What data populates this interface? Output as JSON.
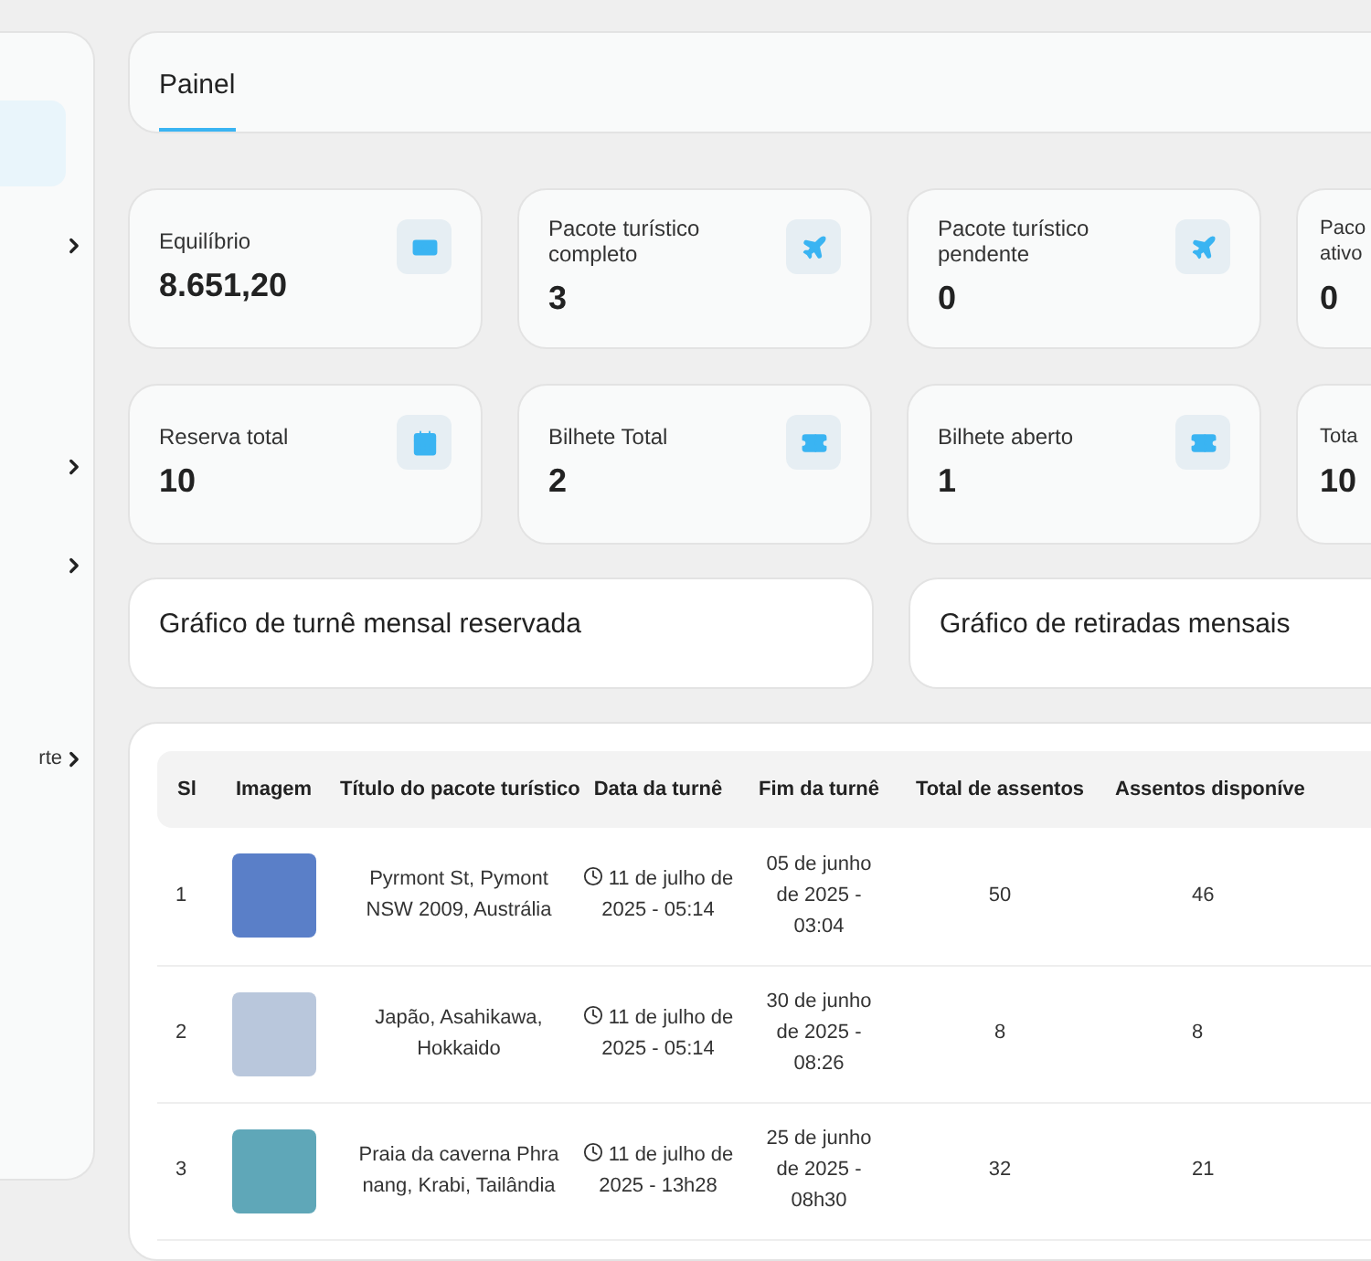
{
  "sidebar": {
    "items": [
      {
        "kind": "highlight"
      },
      {
        "kind": "chevron"
      },
      {
        "kind": "chevron"
      },
      {
        "kind": "chevron"
      },
      {
        "kind": "chevron",
        "label": "rte"
      }
    ]
  },
  "tabs": [
    {
      "label": "Painel",
      "selected": true
    }
  ],
  "stats": [
    {
      "label": "Equilíbrio",
      "value": "8.651,20",
      "kind": "money"
    },
    {
      "label": "Pacote turístico completo",
      "value": "3",
      "kind": "plane"
    },
    {
      "label": "Pacote turístico pendente",
      "value": "0",
      "kind": "plane"
    },
    {
      "label": "Paco ativo",
      "value": "0",
      "kind": "cut"
    },
    {
      "label": "Reserva total",
      "value": "10",
      "kind": "calendar"
    },
    {
      "label": "Bilhete Total",
      "value": "2",
      "kind": "ticket"
    },
    {
      "label": "Bilhete aberto",
      "value": "1",
      "kind": "ticket"
    },
    {
      "label": "Tota",
      "value": "10",
      "kind": "cut"
    }
  ],
  "charts": [
    {
      "title": "Gráfico de turnê mensal reservada"
    },
    {
      "title": "Gráfico de retiradas mensais"
    }
  ],
  "table": {
    "columns": [
      "Sl",
      "Imagem",
      "Título do pacote turístico",
      "Data da turnê",
      "Fim da turnê",
      "Total de assentos",
      "Assentos disponíve"
    ],
    "rows": [
      {
        "sl": "1",
        "title": "Pyrmont St, Pymont NSW 2009, Austrália",
        "date": "11 de julho de 2025 - 05:14",
        "end": "05 de junho de 2025 - 03:04",
        "total": "50",
        "available": "46"
      },
      {
        "sl": "2",
        "title": "Japão, Asahikawa, Hokkaido",
        "date": "11 de julho de 2025 - 05:14",
        "end": "30 de junho de 2025 - 08:26",
        "total": "8",
        "available": "8"
      },
      {
        "sl": "3",
        "title": "Praia da caverna Phra nang, Krabi, Tailândia",
        "date": "11 de julho de 2025 - 13h28",
        "end": "25 de junho de 2025 - 08h30",
        "total": "32",
        "available": "21"
      }
    ]
  }
}
